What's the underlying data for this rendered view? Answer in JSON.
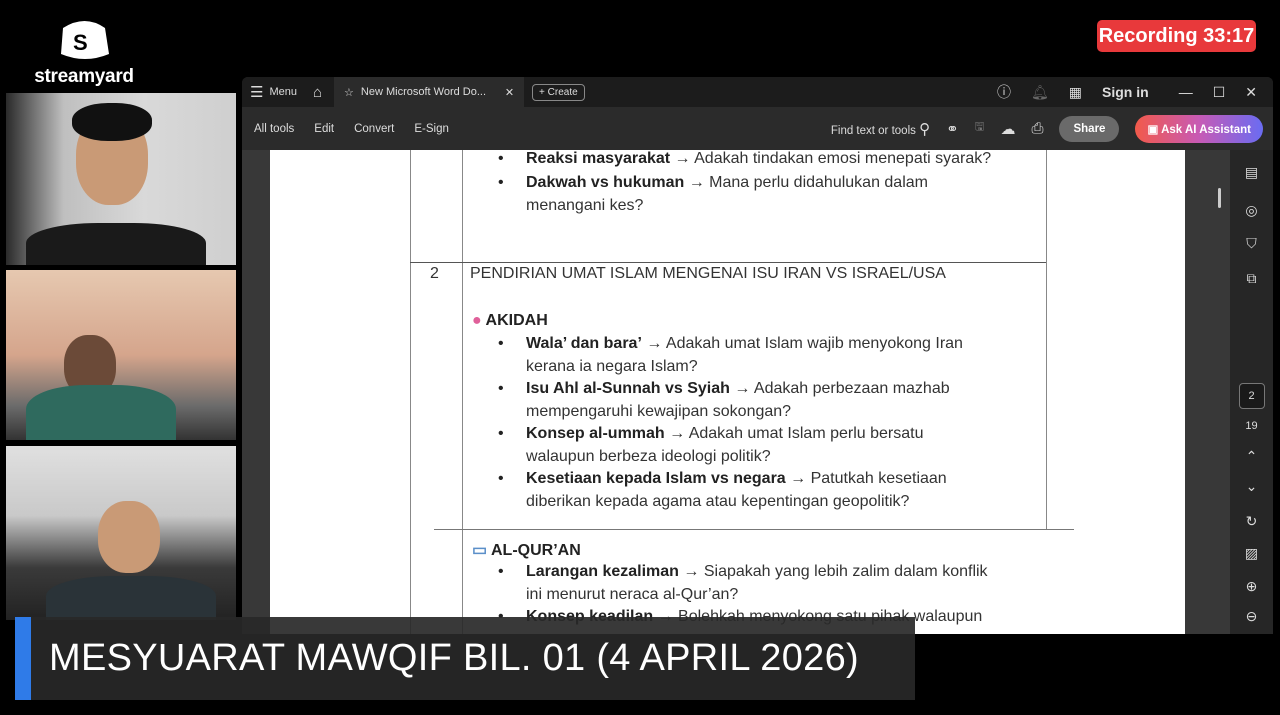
{
  "branding": {
    "name": "streamyard"
  },
  "recording": {
    "label": "Recording 33:17"
  },
  "window": {
    "menu": "Menu",
    "tab_title": "New Microsoft Word Do...",
    "create": "Create",
    "sign_in": "Sign in",
    "toolbar": {
      "all_tools": "All tools",
      "edit": "Edit",
      "convert": "Convert",
      "esign": "E-Sign",
      "find": "Find text or tools",
      "share": "Share",
      "ai": "Ask AI Assistant"
    },
    "page_current": "2",
    "page_total": "19"
  },
  "document": {
    "top_bullets": [
      {
        "bold": "Reaksi masyarakat",
        "text": " → Adakah tindakan emosi menepati syarak?"
      },
      {
        "bold": "Dakwah vs hukuman",
        "text": " → Mana perlu didahulukan dalam",
        "cont": "menangani kes?"
      }
    ],
    "row_number": "2",
    "row_title": "PENDIRIAN UMAT ISLAM MENGENAI ISU IRAN VS ISRAEL/USA",
    "akidah": {
      "heading": "AKIDAH",
      "items": [
        {
          "bold": "Wala’ dan bara’",
          "text": " → Adakah umat Islam wajib menyokong Iran",
          "cont": "kerana ia negara Islam?"
        },
        {
          "bold": "Isu Ahl al-Sunnah vs Syiah",
          "text": " → Adakah perbezaan mazhab",
          "cont": "mempengaruhi kewajipan sokongan?"
        },
        {
          "bold": "Konsep al-ummah",
          "text": " → Adakah umat Islam perlu bersatu",
          "cont": "walaupun berbeza ideologi politik?"
        },
        {
          "bold": "Kesetiaan kepada Islam vs negara",
          "text": " → Patutkah kesetiaan",
          "cont": "diberikan kepada agama atau kepentingan geopolitik?"
        }
      ]
    },
    "quran": {
      "heading": "AL-QUR’AN",
      "items": [
        {
          "bold": "Larangan kezaliman",
          "text": " → Siapakah yang lebih zalim dalam konflik",
          "cont": "ini menurut neraca al-Qur’an?"
        },
        {
          "bold": "Konsep keadilan",
          "text": " → Bolehkah menyokong satu pihak walaupun"
        }
      ]
    }
  },
  "banner": {
    "title": "MESYUARAT MAWQIF BIL. 01 (4 APRIL 2026)"
  }
}
